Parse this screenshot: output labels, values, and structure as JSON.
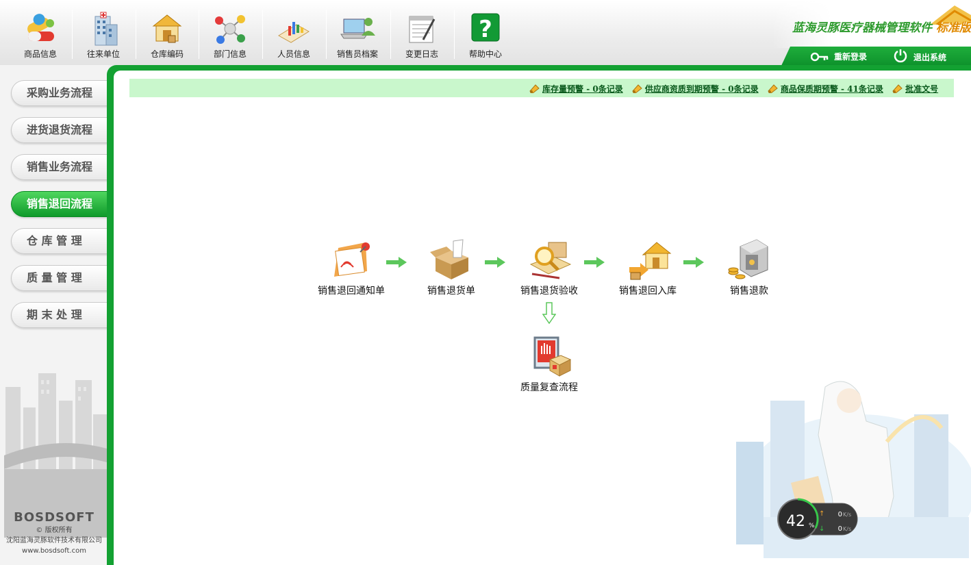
{
  "toolbar": {
    "items": [
      {
        "label": "商品信息",
        "icon": "pills-icon"
      },
      {
        "label": "往来单位",
        "icon": "building-icon"
      },
      {
        "label": "仓库编码",
        "icon": "warehouse-icon"
      },
      {
        "label": "部门信息",
        "icon": "network-icon"
      },
      {
        "label": "人员信息",
        "icon": "chart-person-icon"
      },
      {
        "label": "销售员档案",
        "icon": "laptop-user-icon"
      },
      {
        "label": "变更日志",
        "icon": "notepad-icon"
      },
      {
        "label": "帮助中心",
        "icon": "help-icon"
      }
    ]
  },
  "brand": {
    "title": "蓝海灵豚医疗器械管理软件",
    "edition": "标准版"
  },
  "top_actions": {
    "relogin": "重新登录",
    "logout": "退出系统"
  },
  "sidebar": {
    "items": [
      {
        "label": "采购业务流程",
        "active": false
      },
      {
        "label": "进货退货流程",
        "active": false
      },
      {
        "label": "销售业务流程",
        "active": false
      },
      {
        "label": "销售退回流程",
        "active": true
      },
      {
        "label": "仓 库 管 理",
        "active": false
      },
      {
        "label": "质 量 管 理",
        "active": false
      },
      {
        "label": "期 末 处 理",
        "active": false
      }
    ]
  },
  "copyright": {
    "logo": "BOSDSOFT",
    "line1": "© 版权所有",
    "line2": "沈阳蓝海灵豚软件技术有限公司",
    "line3": "www.bosdsoft.com"
  },
  "alerts": [
    {
      "label": "库存量预警",
      "count": "- 0条记录"
    },
    {
      "label": "供应商资质到期预警",
      "count": "- 0条记录"
    },
    {
      "label": "商品保质期预警",
      "count": "- 41条记录"
    },
    {
      "label": "批准文号",
      "count": ""
    }
  ],
  "flow": {
    "steps": [
      {
        "label": "销售退回通知单",
        "icon": "notice-icon"
      },
      {
        "label": "销售退货单",
        "icon": "box-icon"
      },
      {
        "label": "销售退货验收",
        "icon": "inspect-icon"
      },
      {
        "label": "销售退回入库",
        "icon": "house-icon"
      },
      {
        "label": "销售退款",
        "icon": "safe-icon"
      }
    ],
    "sub": {
      "label": "质量复查流程",
      "icon": "quality-icon"
    }
  },
  "widget": {
    "percent": "42",
    "percent_unit": "%",
    "up": "0",
    "down": "0",
    "unit": "K/s"
  },
  "colors": {
    "green": "#13a132",
    "alert_bg": "#c9f7cc",
    "alert_text": "#0a5a1c",
    "brand": "#2e9b2e",
    "edition": "#e08a00"
  }
}
